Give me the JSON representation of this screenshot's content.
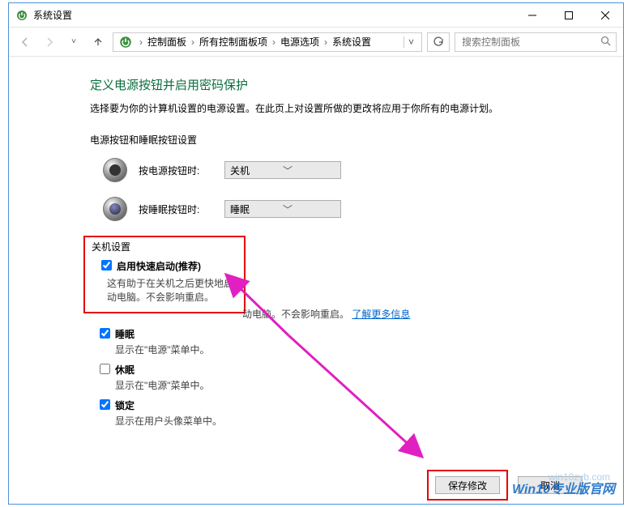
{
  "window": {
    "title": "系统设置"
  },
  "breadcrumb": {
    "items": [
      "控制面板",
      "所有控制面板项",
      "电源选项",
      "系统设置"
    ]
  },
  "search": {
    "placeholder": "搜索控制面板"
  },
  "page": {
    "heading": "定义电源按钮并启用密码保护",
    "description": "选择要为你的计算机设置的电源设置。在此页上对设置所做的更改将应用于你所有的电源计划。",
    "buttons_section": "电源按钮和睡眠按钮设置",
    "power_button_label": "按电源按钮时:",
    "power_button_value": "关机",
    "sleep_button_label": "按睡眠按钮时:",
    "sleep_button_value": "睡眠",
    "shutdown_section": "关机设置",
    "opts": [
      {
        "label": "启用快速启动(推荐)",
        "checked": true,
        "sub_a": "这有助于在关机之后更快地启动电脑。不会影响重启。",
        "link": "了解更多信息"
      },
      {
        "label": "睡眠",
        "checked": true,
        "sub": "显示在\"电源\"菜单中。"
      },
      {
        "label": "休眠",
        "checked": false,
        "sub": "显示在\"电源\"菜单中。"
      },
      {
        "label": "锁定",
        "checked": true,
        "sub": "显示在用户头像菜单中。"
      }
    ]
  },
  "footer": {
    "save": "保存修改",
    "cancel": "取消"
  },
  "watermark": {
    "main": "Win10专业版官网",
    "url": "win10zyb.com"
  }
}
